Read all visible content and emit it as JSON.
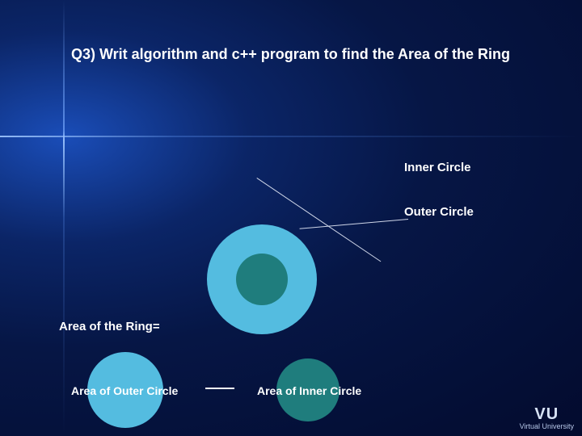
{
  "title": "Q3) Writ algorithm and c++ program to find the Area of the Ring",
  "labels": {
    "inner": "Inner Circle",
    "outer": "Outer Circle"
  },
  "equation": {
    "lhs": "Area of the Ring=",
    "outer_term": "Area of Outer Circle",
    "inner_term": "Area of Inner Circle"
  },
  "logo": {
    "initials": "VU",
    "name": "Virtual University"
  },
  "colors": {
    "outer_circle": "#54bce0",
    "inner_circle": "#1f7d7d",
    "text": "#ffffff"
  }
}
